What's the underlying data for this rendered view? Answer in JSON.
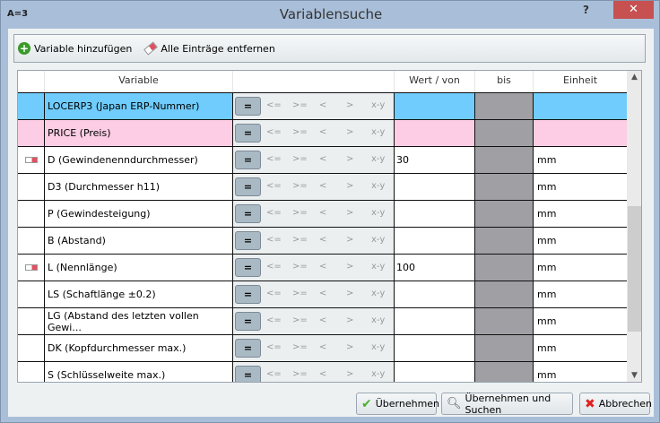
{
  "window": {
    "app_label": "A=3",
    "title": "Variablensuche",
    "help": "?",
    "close": "✕"
  },
  "toolbar": {
    "add": "Variable hinzufügen",
    "clear": "Alle Einträge entfernen"
  },
  "columns": {
    "variable": "Variable",
    "von": "Wert / von",
    "bis": "bis",
    "unit": "Einheit"
  },
  "operators": [
    "=",
    "<=",
    ">=",
    "<",
    ">",
    "x-y"
  ],
  "rows": [
    {
      "name": "LOCERP3 (Japan ERP-Nummer)",
      "value": "",
      "unit": "",
      "style": "blue",
      "eraser": false
    },
    {
      "name": "PRICE (Preis)",
      "value": "",
      "unit": "",
      "style": "pink",
      "eraser": false
    },
    {
      "name": "D (Gewindenenndurchmesser)",
      "value": "30",
      "unit": "mm",
      "style": "",
      "eraser": true
    },
    {
      "name": "D3 (Durchmesser h11)",
      "value": "",
      "unit": "mm",
      "style": "",
      "eraser": false
    },
    {
      "name": "P (Gewindesteigung)",
      "value": "",
      "unit": "mm",
      "style": "",
      "eraser": false
    },
    {
      "name": "B (Abstand)",
      "value": "",
      "unit": "mm",
      "style": "",
      "eraser": false
    },
    {
      "name": "L (Nennlänge)",
      "value": "100",
      "unit": "mm",
      "style": "",
      "eraser": true
    },
    {
      "name": "LS (Schaftlänge ±0.2)",
      "value": "",
      "unit": "mm",
      "style": "",
      "eraser": false
    },
    {
      "name": "LG (Abstand des letzten vollen Gewi...",
      "value": "",
      "unit": "mm",
      "style": "",
      "eraser": false
    },
    {
      "name": "DK (Kopfdurchmesser max.)",
      "value": "",
      "unit": "mm",
      "style": "",
      "eraser": false
    },
    {
      "name": "S (Schlüsselweite max.)",
      "value": "",
      "unit": "mm",
      "style": "",
      "eraser": false
    }
  ],
  "buttons": {
    "apply": "Übernehmen",
    "apply_search": "Übernehmen und Suchen",
    "cancel": "Abbrechen"
  }
}
